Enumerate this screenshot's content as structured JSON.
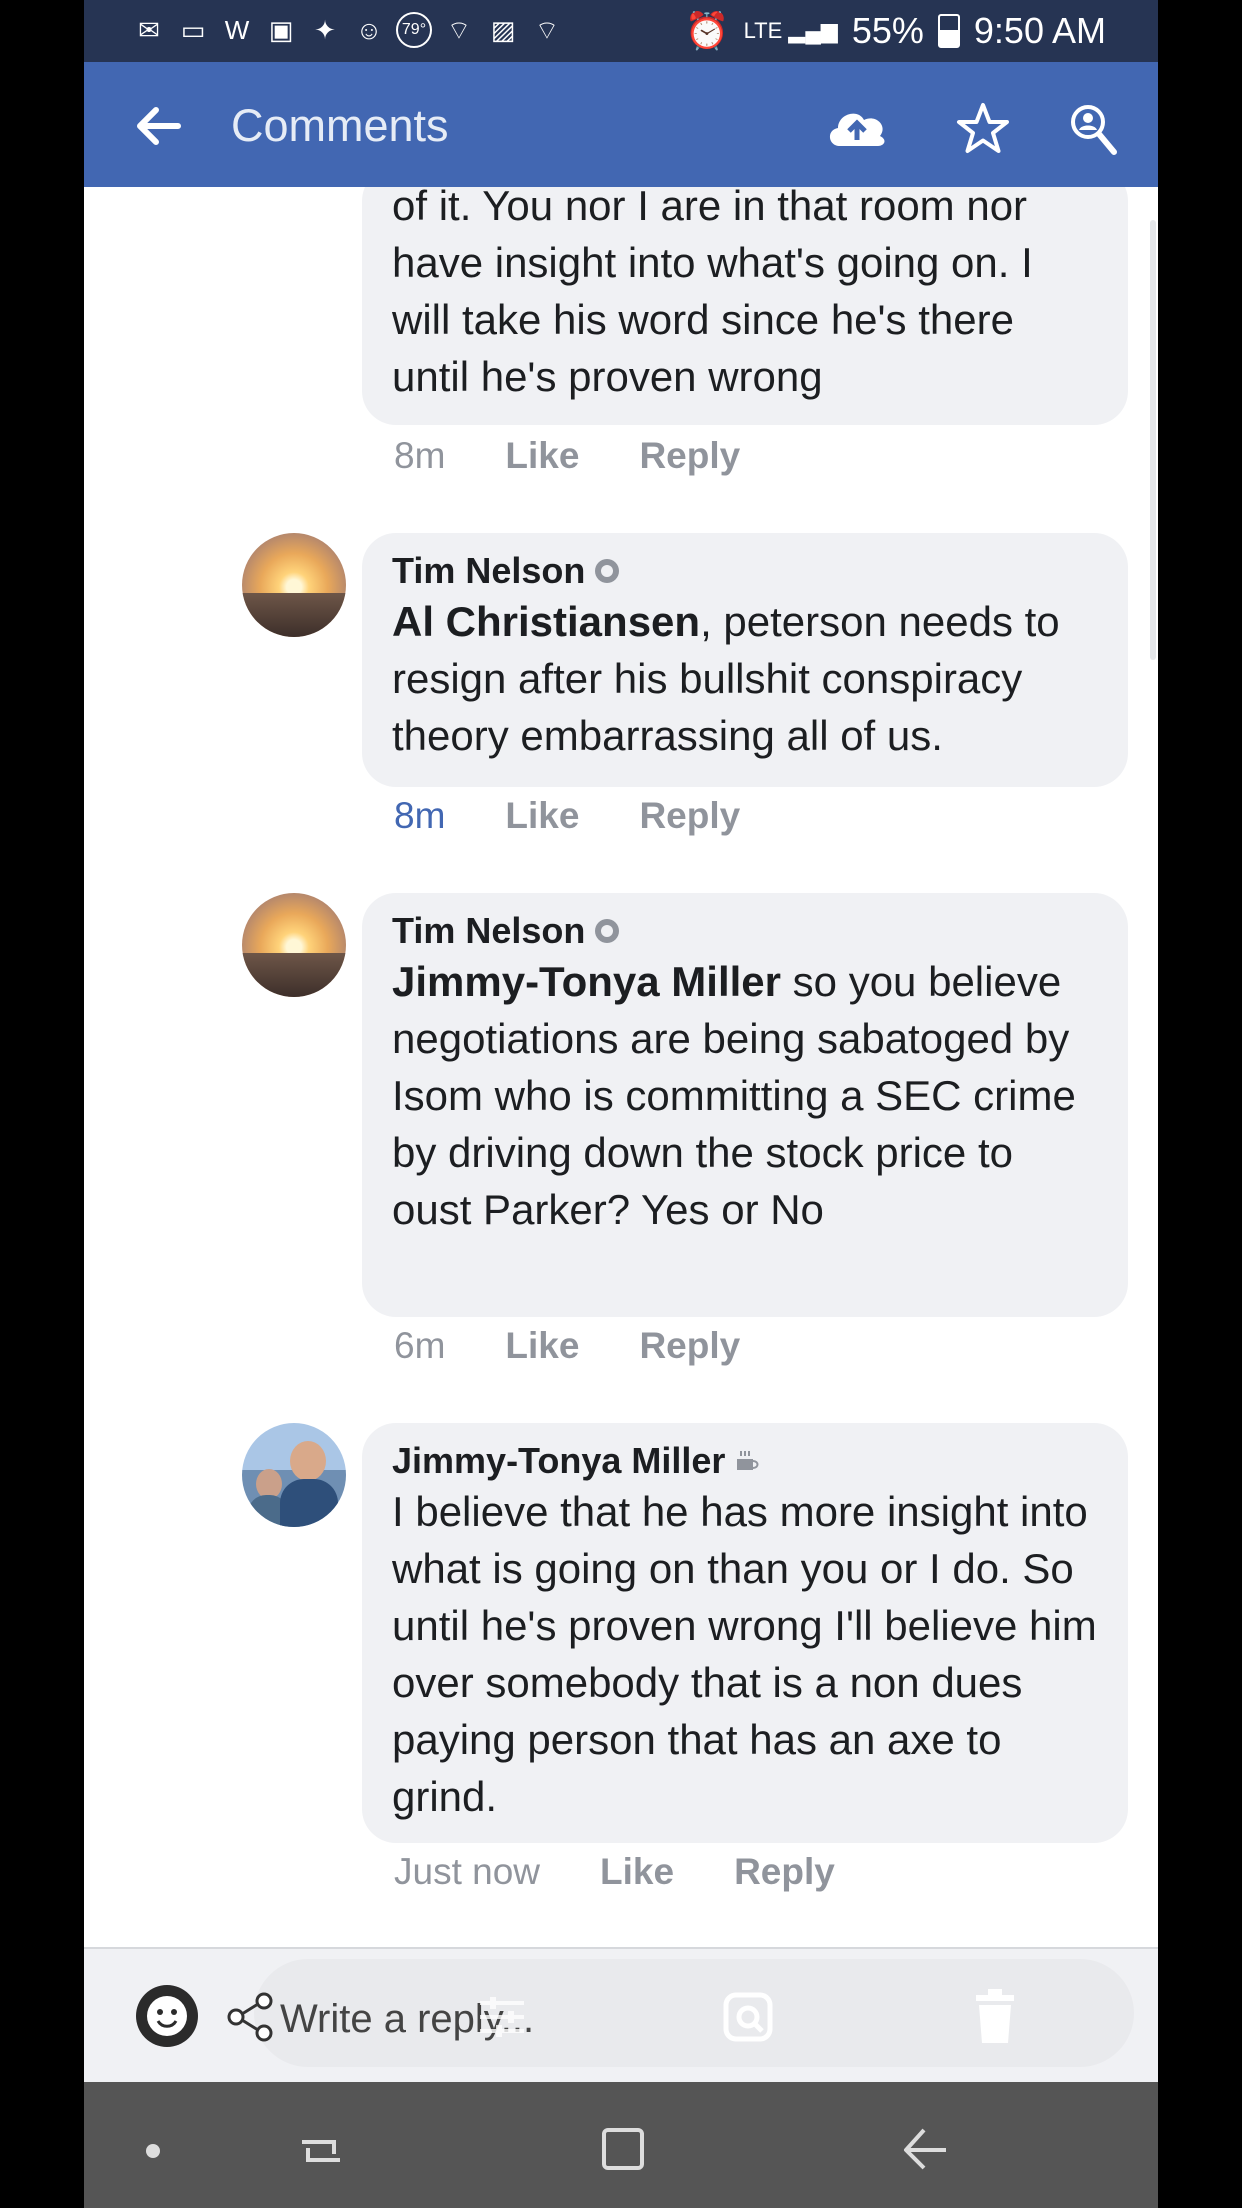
{
  "status_bar": {
    "temperature": "79°",
    "network": "LTE",
    "battery_percent": "55%",
    "battery_level": 0.55,
    "time": "9:50 AM"
  },
  "app_bar": {
    "title": "Comments"
  },
  "comments": [
    {
      "author": "",
      "mention": "",
      "text": "of it.  You nor I are in that room nor have insight into what's going on.  I will take his word since he's there until he's proven wrong",
      "time": "8m",
      "like": "Like",
      "reply": "Reply"
    },
    {
      "author": "Tim Nelson",
      "mention": "Al Christiansen",
      "text": ", peterson needs to resign after his bullshit conspiracy theory embarrassing all of us.",
      "time": "8m",
      "like": "Like",
      "reply": "Reply"
    },
    {
      "author": "Tim Nelson",
      "mention": "Jimmy-Tonya Miller",
      "text": " so you believe negotiations are being sabatoged by Isom who is committing a SEC crime by driving down the stock price to oust Parker? Yes or No",
      "time": "6m",
      "like": "Like",
      "reply": "Reply"
    },
    {
      "author": "Jimmy-Tonya Miller",
      "mention": "",
      "text": "I believe that he has more insight into what is going on than you or I do.  So until he's proven wrong I'll believe him over somebody that is a non dues paying person that has an axe to grind.",
      "time": "Just now",
      "like": "Like",
      "reply": "Reply"
    }
  ],
  "composer": {
    "placeholder": "Write a reply..."
  },
  "colors": {
    "status_bar": "#263453",
    "app_bar": "#4267b2",
    "bubble": "#f0f1f4",
    "meta": "#90949c",
    "link_time": "#4267b2"
  }
}
